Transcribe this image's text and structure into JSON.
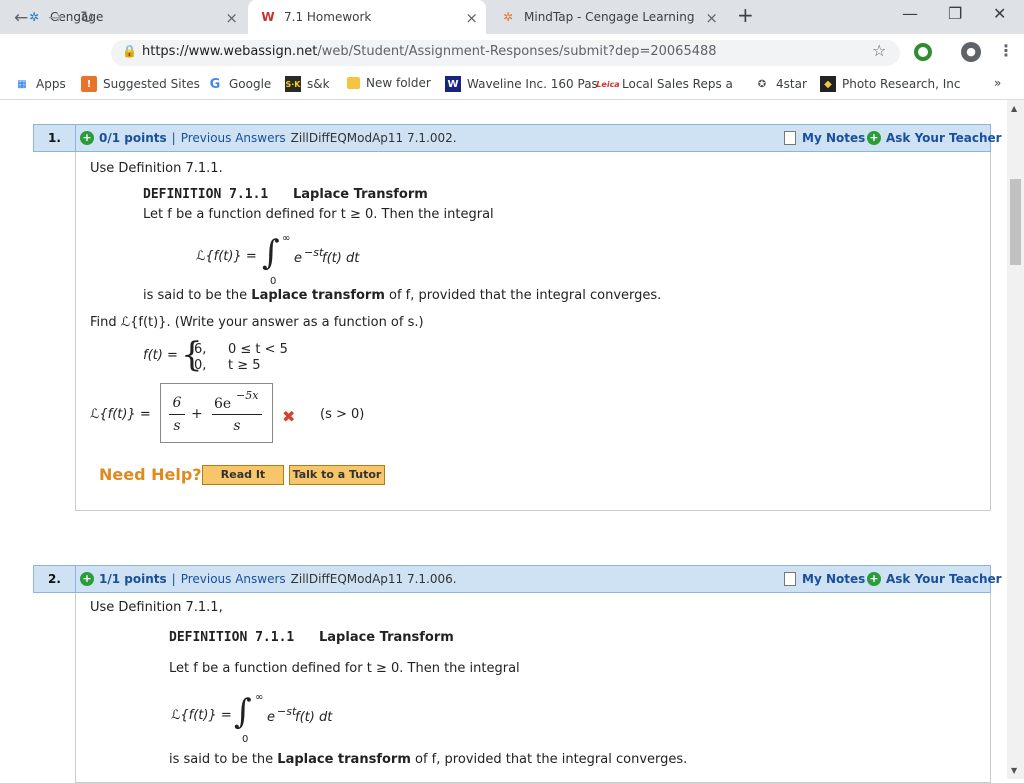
{
  "browser": {
    "tabs": [
      {
        "title": "Cengage",
        "icon": "cengage-icon",
        "close": "×"
      },
      {
        "title": "7.1 Homework",
        "icon": "webassign-icon",
        "close": "×"
      },
      {
        "title": "MindTap - Cengage Learning",
        "icon": "mindtap-icon",
        "close": "×"
      }
    ],
    "new_tab": "+",
    "window_controls": {
      "minimize": "—",
      "restore": "❐",
      "close": "✕"
    },
    "nav": {
      "back": "←",
      "forward": "→",
      "reload": "↻"
    },
    "url_host": "https://www.webassign.net",
    "url_path": "/web/Student/Assignment-Responses/submit?dep=20065488",
    "bookmarks": [
      {
        "label": "Apps",
        "icon": "apps-grid-icon"
      },
      {
        "label": "Suggested Sites",
        "icon": "suggested-sites-icon"
      },
      {
        "label": "Google",
        "icon": "google-icon"
      },
      {
        "label": "s&k",
        "icon": "sk-icon"
      },
      {
        "label": "New folder",
        "icon": "folder-icon"
      },
      {
        "label": "Waveline Inc. 160 Pas",
        "icon": "waveline-icon"
      },
      {
        "label": "Local Sales Reps and",
        "icon": "leica-icon"
      },
      {
        "label": "4star",
        "icon": "4star-icon"
      },
      {
        "label": "Photo Research, Inc. -",
        "icon": "photo-research-icon"
      }
    ],
    "bookmarks_more": "»"
  },
  "questions": [
    {
      "number": "1.",
      "points": "0/1 points",
      "separator": "|",
      "previous_answers": "Previous Answers",
      "source": "ZillDiffEQModAp11 7.1.002.",
      "my_notes": "My Notes",
      "ask_teacher": "Ask Your Teacher",
      "intro": "Use Definition 7.1.1.",
      "def_label": "DEFINITION 7.1.1",
      "def_title": "Laplace Transform",
      "def_let": "Let f be a function defined for t ≥ 0. Then the integral",
      "def_lhs": "ℒ{f(t)} =",
      "int_upper": "∞",
      "int_lower": "0",
      "int_body": "e",
      "int_exp": "−st",
      "int_tail": "f(t) dt",
      "def_said_pre": "is said to be the",
      "def_said_bold": "Laplace transform",
      "def_said_post": "of f, provided that the integral converges.",
      "find": "Find ℒ{f(t)}. (Write your answer as a function of s.)",
      "ft_lhs": "f(t) =",
      "case1_val": "6,",
      "case1_cond": "0 ≤ t < 5",
      "case2_val": "0,",
      "case2_cond": "t ≥ 5",
      "answer_lhs": "ℒ{f(t)} =",
      "ans_num1": "6",
      "ans_den1": "s",
      "ans_plus": "+",
      "ans_num2": "6e",
      "ans_num2_exp": "−5x",
      "ans_den2": "s",
      "status": "✖",
      "condition": "(s > 0)",
      "need_help": "Need Help?",
      "read_it": "Read It",
      "talk_tutor": "Talk to a Tutor"
    },
    {
      "number": "2.",
      "points": "1/1 points",
      "separator": "|",
      "previous_answers": "Previous Answers",
      "source": "ZillDiffEQModAp11 7.1.006.",
      "my_notes": "My Notes",
      "ask_teacher": "Ask Your Teacher",
      "intro": "Use Definition 7.1.1,",
      "def_label": "DEFINITION 7.1.1",
      "def_title": "Laplace Transform",
      "def_let": "Let f be a function defined for t ≥ 0. Then the integral",
      "def_lhs": "ℒ{f(t)} =",
      "int_upper": "∞",
      "int_lower": "0",
      "int_body": "e",
      "int_exp": "−st",
      "int_tail": "f(t) dt",
      "def_said_pre": "is said to be the",
      "def_said_bold": "Laplace transform",
      "def_said_post": "of f, provided that the integral converges."
    }
  ]
}
